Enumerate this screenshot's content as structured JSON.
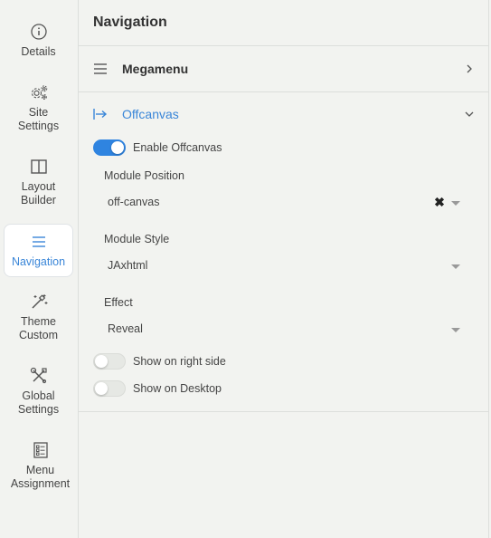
{
  "sidebar": {
    "items": [
      {
        "label": "Details",
        "icon": "info-circle-icon"
      },
      {
        "label": "Site Settings",
        "icon": "gears-icon"
      },
      {
        "label": "Layout Builder",
        "icon": "layout-columns-icon"
      },
      {
        "label": "Navigation",
        "icon": "hamburger-icon",
        "active": true
      },
      {
        "label": "Theme Custom",
        "icon": "magic-wand-icon"
      },
      {
        "label": "Global Settings",
        "icon": "tools-icon"
      },
      {
        "label": "Menu Assignment",
        "icon": "checklist-icon"
      }
    ]
  },
  "panel": {
    "title": "Navigation",
    "megamenu": {
      "label": "Megamenu",
      "icon": "hamburger-icon",
      "chevron": "chevron-right-icon"
    },
    "offcanvas": {
      "label": "Offcanvas",
      "icon": "arrow-to-right-bar-icon",
      "chevron": "chevron-down-icon",
      "enable_label": "Enable Offcanvas",
      "enable_on": true,
      "module_position_label": "Module Position",
      "module_position_value": "off-canvas",
      "module_style_label": "Module Style",
      "module_style_value": "JAxhtml",
      "effect_label": "Effect",
      "effect_value": "Reveal",
      "right_side_label": "Show on right side",
      "right_side_on": false,
      "desktop_label": "Show on Desktop",
      "desktop_on": false
    }
  },
  "colors": {
    "accent": "#3a86d8",
    "toggle_on": "#2f84e0",
    "background": "#f2f3f0",
    "border": "#dcdedb"
  }
}
